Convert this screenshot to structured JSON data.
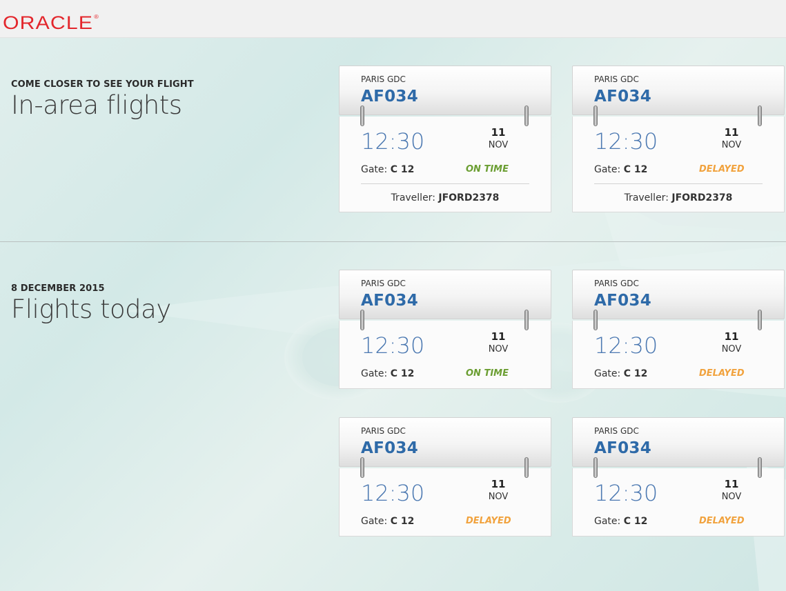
{
  "header": {
    "logo": "ORACLE",
    "logo_mark": "®"
  },
  "sections": [
    {
      "kicker": "COME CLOSER TO SEE YOUR FLIGHT",
      "title": "In-area flights"
    },
    {
      "kicker": "8 DECEMBER 2015",
      "title": "Flights today"
    }
  ],
  "labels": {
    "gate": "Gate:",
    "traveller": "Traveller:"
  },
  "flights": [
    {
      "city": "PARIS GDC",
      "code": "AF034",
      "time": "12:30",
      "day": "11",
      "month": "NOV",
      "gate": "C 12",
      "status": "ON TIME",
      "traveller": "JFORD2378"
    },
    {
      "city": "PARIS GDC",
      "code": "AF034",
      "time": "12:30",
      "day": "11",
      "month": "NOV",
      "gate": "C 12",
      "status": "DELAYED",
      "traveller": "JFORD2378"
    },
    {
      "city": "PARIS GDC",
      "code": "AF034",
      "time": "12:30",
      "day": "11",
      "month": "NOV",
      "gate": "C 12",
      "status": "ON TIME"
    },
    {
      "city": "PARIS GDC",
      "code": "AF034",
      "time": "12:30",
      "day": "11",
      "month": "NOV",
      "gate": "C 12",
      "status": "DELAYED"
    },
    {
      "city": "PARIS GDC",
      "code": "AF034",
      "time": "12:30",
      "day": "11",
      "month": "NOV",
      "gate": "C 12",
      "status": "DELAYED"
    },
    {
      "city": "PARIS GDC",
      "code": "AF034",
      "time": "12:30",
      "day": "11",
      "month": "NOV",
      "gate": "C 12",
      "status": "DELAYED"
    }
  ],
  "colors": {
    "brand": "#e3262c",
    "flight_code": "#2e6aa8",
    "time": "#4b78b1",
    "on_time": "#6b9e32",
    "delayed": "#f1a23d"
  }
}
